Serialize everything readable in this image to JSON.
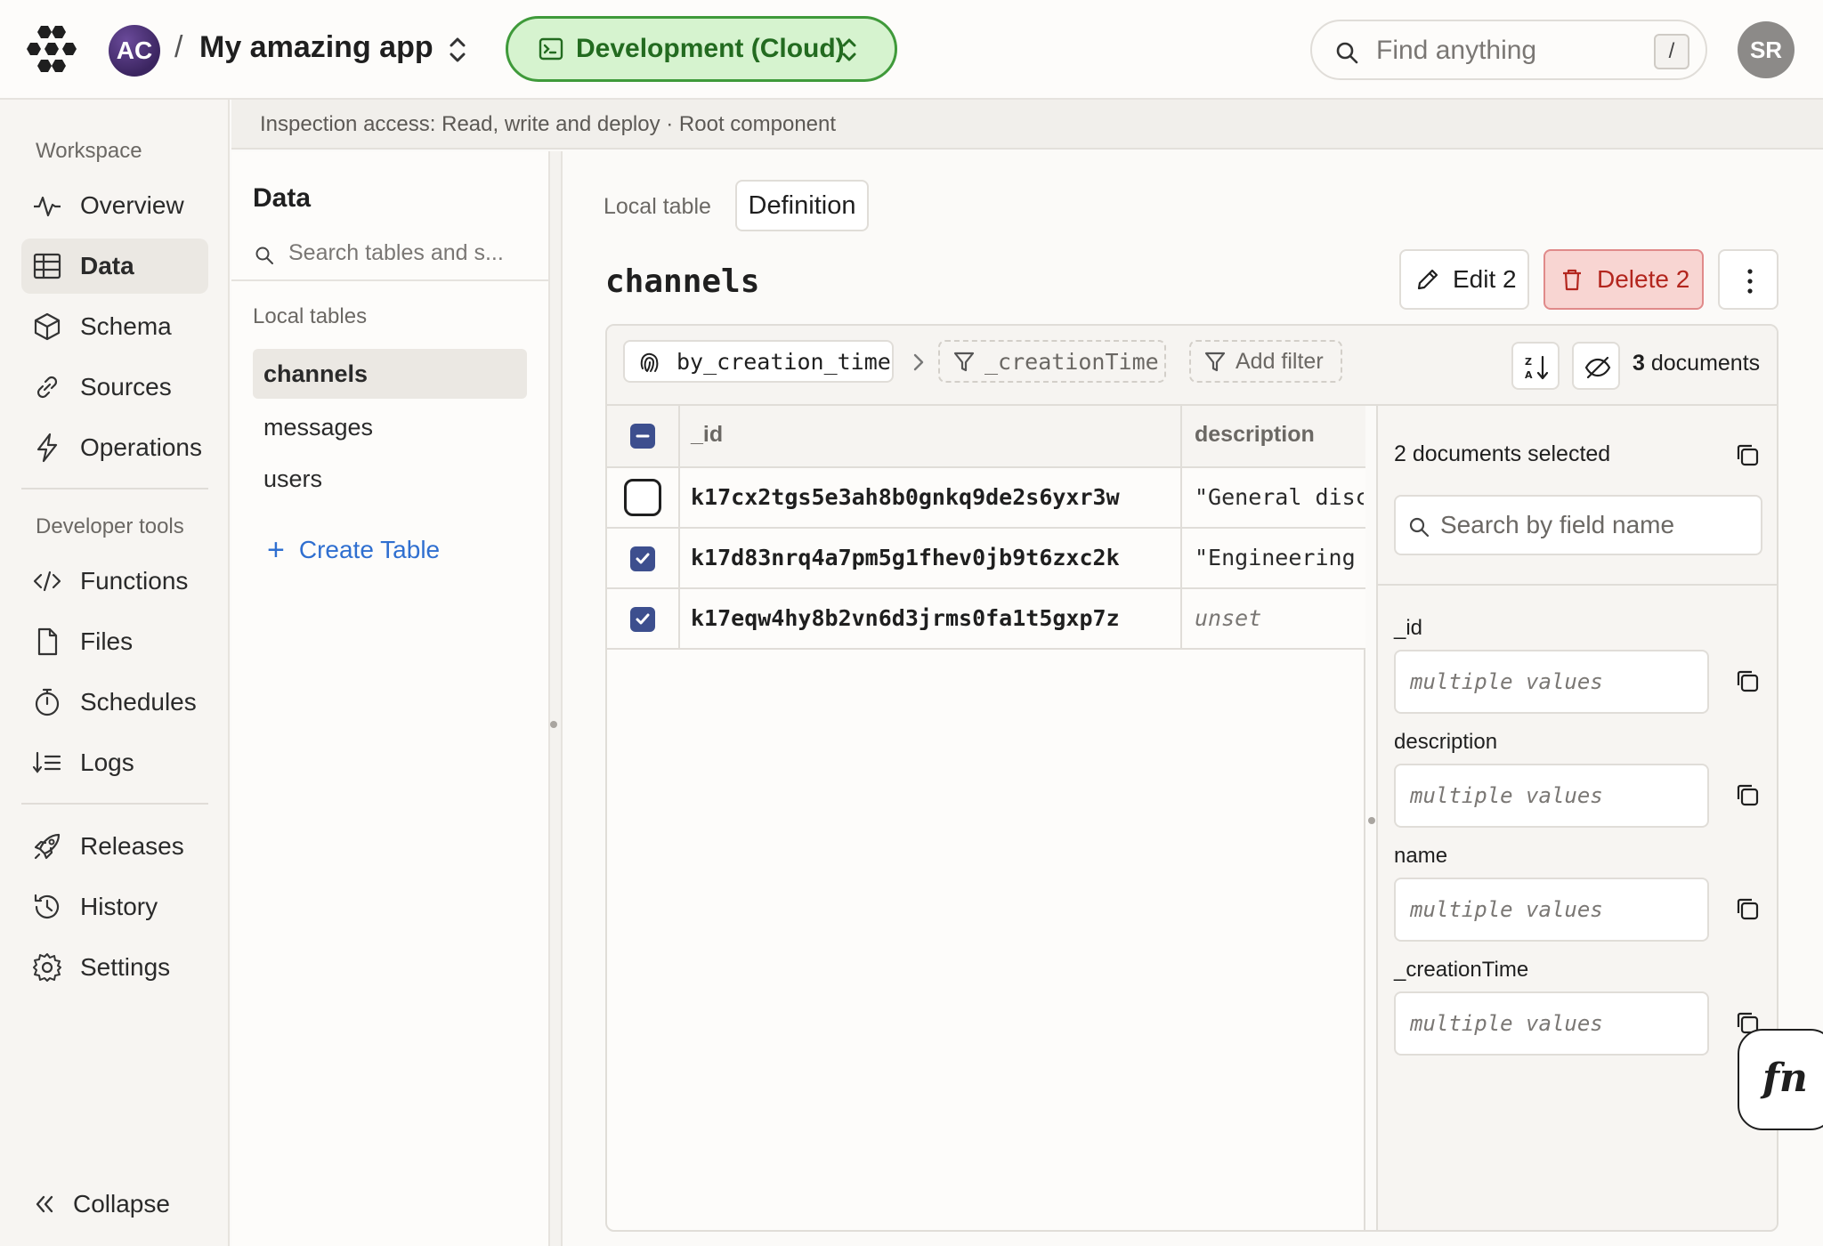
{
  "header": {
    "team_initials": "AC",
    "separator": "/",
    "project_name": "My amazing app",
    "deployment_label": "Development (Cloud)",
    "search_placeholder": "Find anything",
    "search_shortcut": "/",
    "user_initials": "SR",
    "deployment_color": "#d6f3cf"
  },
  "sidebar": {
    "workspace_heading": "Workspace",
    "workspace_items": [
      {
        "label": "Overview",
        "icon": "activity-icon"
      },
      {
        "label": "Data",
        "icon": "table-icon",
        "active": true
      },
      {
        "label": "Schema",
        "icon": "cube-icon"
      },
      {
        "label": "Sources",
        "icon": "link-icon"
      },
      {
        "label": "Operations",
        "icon": "lightning-icon"
      }
    ],
    "devtools_heading": "Developer tools",
    "devtools_items": [
      {
        "label": "Functions",
        "icon": "code-icon"
      },
      {
        "label": "Files",
        "icon": "file-icon"
      },
      {
        "label": "Schedules",
        "icon": "stopwatch-icon"
      },
      {
        "label": "Logs",
        "icon": "logs-icon"
      }
    ],
    "bottom_items": [
      {
        "label": "Releases",
        "icon": "rocket-icon"
      },
      {
        "label": "History",
        "icon": "history-icon"
      },
      {
        "label": "Settings",
        "icon": "gear-icon"
      }
    ],
    "collapse_label": "Collapse"
  },
  "banner": {
    "text": "Inspection access: Read, write and deploy · Root component"
  },
  "tables_panel": {
    "title": "Data",
    "search_placeholder": "Search tables and s...",
    "section_heading": "Local tables",
    "tables": [
      "channels",
      "messages",
      "users"
    ],
    "active_table": "channels",
    "create_label": "Create Table"
  },
  "main": {
    "tabs": [
      "Local table",
      "Definition"
    ],
    "table_name": "channels",
    "edit_label": "Edit 2",
    "delete_label": "Delete 2",
    "filter": {
      "index_label": "by_creation_time",
      "index_field": "_creationTime",
      "add_filter_label": "Add filter",
      "doc_count": "3",
      "doc_count_suffix": "documents"
    },
    "columns": [
      "_id",
      "description"
    ],
    "rows": [
      {
        "id": "k17cx2tgs5e3ah8b0gnkq9de2s6yxr3w",
        "description": "\"General discu",
        "selected": false,
        "unset": false
      },
      {
        "id": "k17d83nrq4a7pm5g1fhev0jb9t6zxc2k",
        "description": "\"Engineering t",
        "selected": true,
        "unset": false
      },
      {
        "id": "k17eqw4hy8b2vn6d3jrms0fa1t5gxp7z",
        "description": "unset",
        "selected": true,
        "unset": true
      }
    ]
  },
  "editor": {
    "title": "2 documents selected",
    "search_placeholder": "Search by field name",
    "fields": [
      {
        "name": "_id",
        "value": "multiple values"
      },
      {
        "name": "description",
        "value": "multiple values"
      },
      {
        "name": "name",
        "value": "multiple values"
      },
      {
        "name": "_creationTime",
        "value": "multiple values"
      }
    ]
  },
  "fn_button": {
    "label": "fn"
  },
  "colors": {
    "accent_link": "#2f6fd0",
    "checkbox": "#3d4f8e",
    "danger_bg": "#f8d5d2",
    "danger_text": "#b3261e"
  }
}
